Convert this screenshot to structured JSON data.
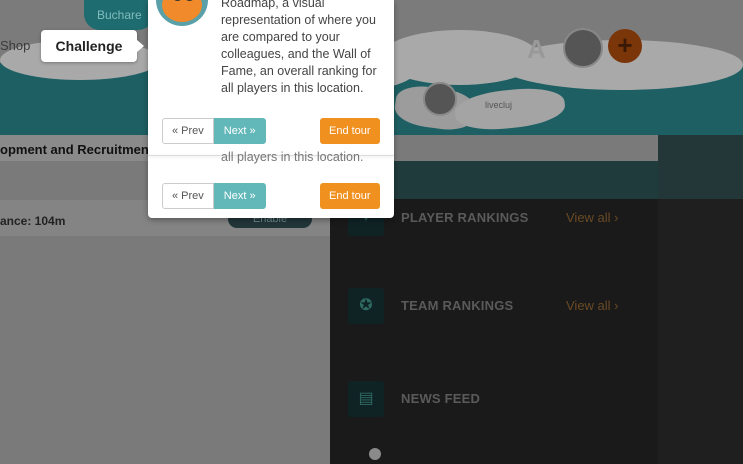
{
  "header": {
    "city_pill": "Buchare",
    "shop_link": "Shop",
    "user_initial": "A",
    "add_button": "+"
  },
  "hero": {
    "pillow_label": "livecluj"
  },
  "breadcrumb": {
    "text": "opment and Recruitment"
  },
  "challenge": {
    "distance": "ance: 104m",
    "enable_button": "Enable"
  },
  "challenge_tip": {
    "label": "Challenge"
  },
  "tour": {
    "text_lines": [
      "Roadmap, a visual",
      "representation of where you",
      "are compared to your",
      "colleagues, and the Wall of",
      "Fame, an overall ranking for",
      "all players in this location."
    ],
    "ghost_text": "all players in this location.",
    "prev_label": "« Prev",
    "next_label": "Next »",
    "end_label": "End tour"
  },
  "rankings": {
    "player_title": "PLAYER RANKINGS",
    "player_link": "View all ›",
    "team_title": "TEAM RANKINGS",
    "team_link": "View all ›",
    "news_title": "NEWS FEED"
  }
}
